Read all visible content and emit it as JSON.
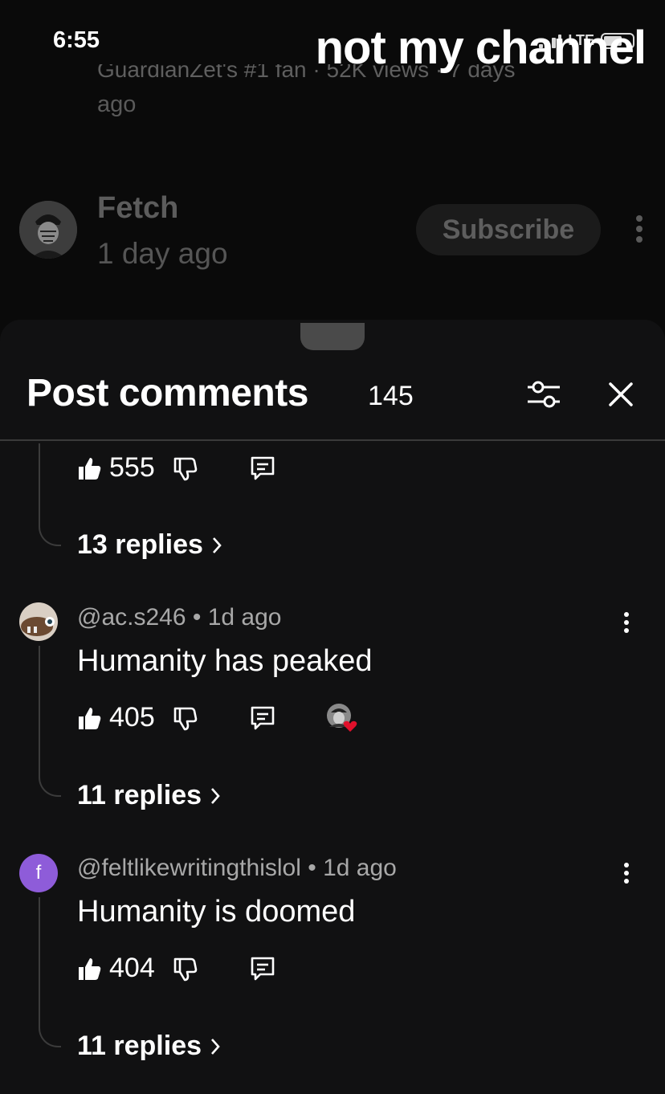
{
  "status_bar": {
    "time": "6:55",
    "network": "LTE"
  },
  "overlay_caption": "not my channel",
  "post_meta": {
    "clipped_line": "GuardianZet's #1 fan · 52K views · 7 days",
    "ago": "ago"
  },
  "channel": {
    "name": "Fetch",
    "time": "1 day ago",
    "subscribe_label": "Subscribe"
  },
  "sheet": {
    "title": "Post comments",
    "count": "145"
  },
  "comments": [
    {
      "likes": "555",
      "replies": "13 replies"
    },
    {
      "handle": "@ac.s246",
      "time": "1d ago",
      "text": "Humanity has peaked",
      "likes": "405",
      "replies": "11 replies",
      "creator_heart": true
    },
    {
      "handle": "@feltlikewritingthislol",
      "time": "1d ago",
      "avatar_letter": "f",
      "text": "Humanity is doomed",
      "likes": "404",
      "replies": "11 replies"
    }
  ],
  "colors": {
    "background": "#0a0a0a",
    "sheet": "#111112",
    "heart": "#e0102b",
    "avatar_purple": "#8e5cd9"
  },
  "icons": [
    "thumb-up-icon",
    "thumb-down-icon",
    "reply-icon",
    "more-vert-icon",
    "filter-icon",
    "close-icon",
    "chevron-right-icon",
    "heart-icon"
  ]
}
